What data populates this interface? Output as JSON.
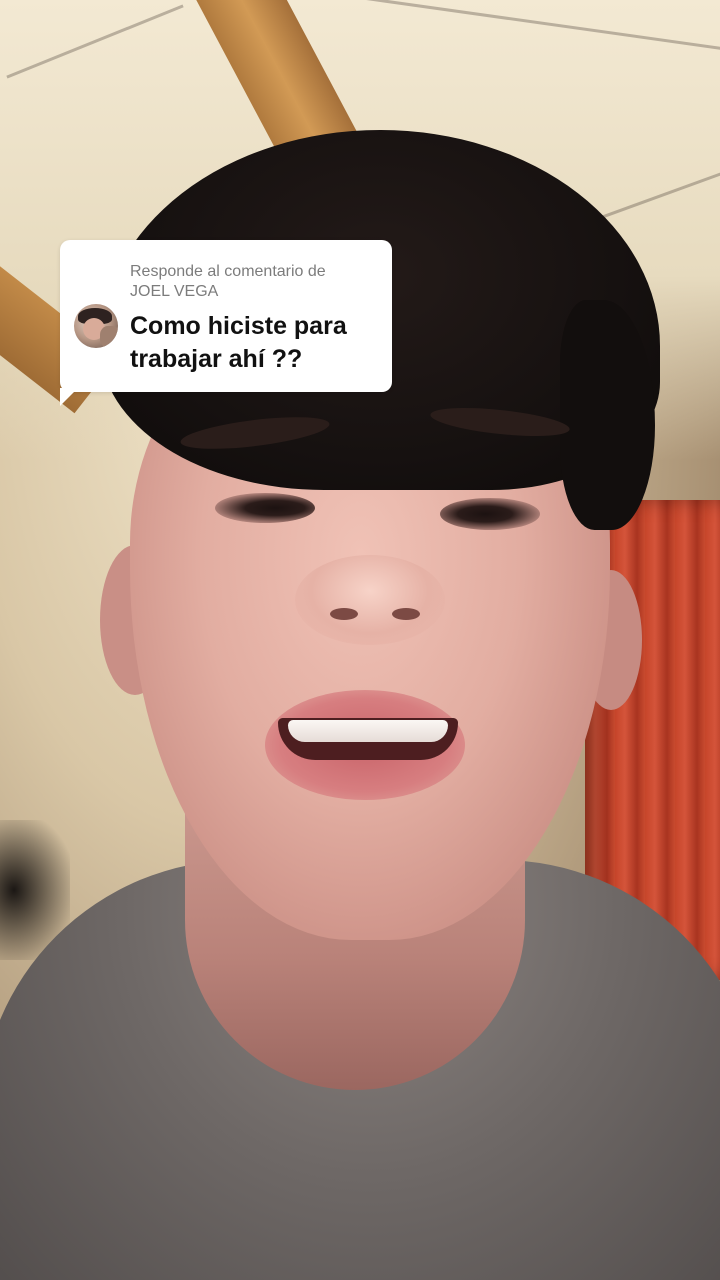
{
  "reply_bubble": {
    "header_prefix": "Responde al comentario de",
    "username": "JOEL VEGA",
    "comment": "Como hiciste para trabajar ahí ??"
  },
  "icons": {
    "avatar": "commenter-avatar"
  },
  "colors": {
    "bubble_background": "#ffffff",
    "header_text": "#7c7c7c",
    "comment_text": "#111111"
  }
}
